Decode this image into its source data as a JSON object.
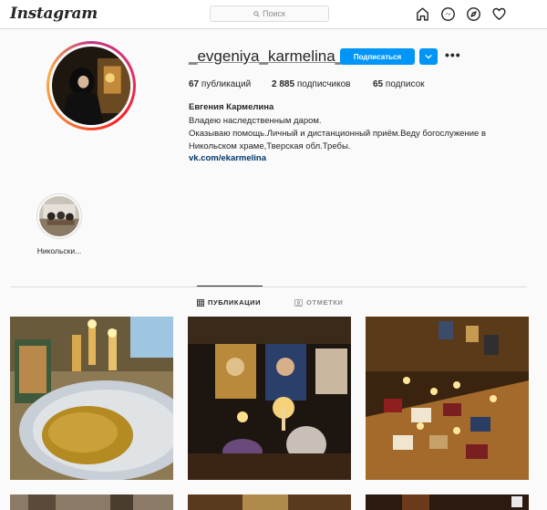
{
  "header": {
    "logo": "Instagram",
    "search_placeholder": "Поиск",
    "icons": [
      "home-icon",
      "messenger-icon",
      "explore-icon",
      "heart-icon"
    ]
  },
  "profile": {
    "username": "_evgeniya_karmelina_",
    "follow_label": "Подписаться",
    "stats": {
      "posts_count": "67",
      "posts_label": "публикаций",
      "followers_count": "2 885",
      "followers_label": "подписчиков",
      "following_count": "65",
      "following_label": "подписок"
    },
    "full_name": "Евгения Кармелина",
    "bio_lines": [
      "Владею наследственным даром.",
      "Оказываю помощь.Личный и дистанционный приём.Веду богослужение в",
      "Никольском храме,Тверская обл.Требы."
    ],
    "link": "vk.com/ekarmelina"
  },
  "highlights": [
    {
      "label": "Никольски..."
    }
  ],
  "tabs": [
    {
      "label": "ПУБЛИКАЦИИ",
      "active": true,
      "icon": "grid-icon"
    },
    {
      "label": "ОТМЕТКИ",
      "active": false,
      "icon": "tag-icon"
    }
  ],
  "colors": {
    "accent": "#0095f6",
    "link": "#00376b",
    "border": "#dbdbdb",
    "background": "#fafafa"
  }
}
